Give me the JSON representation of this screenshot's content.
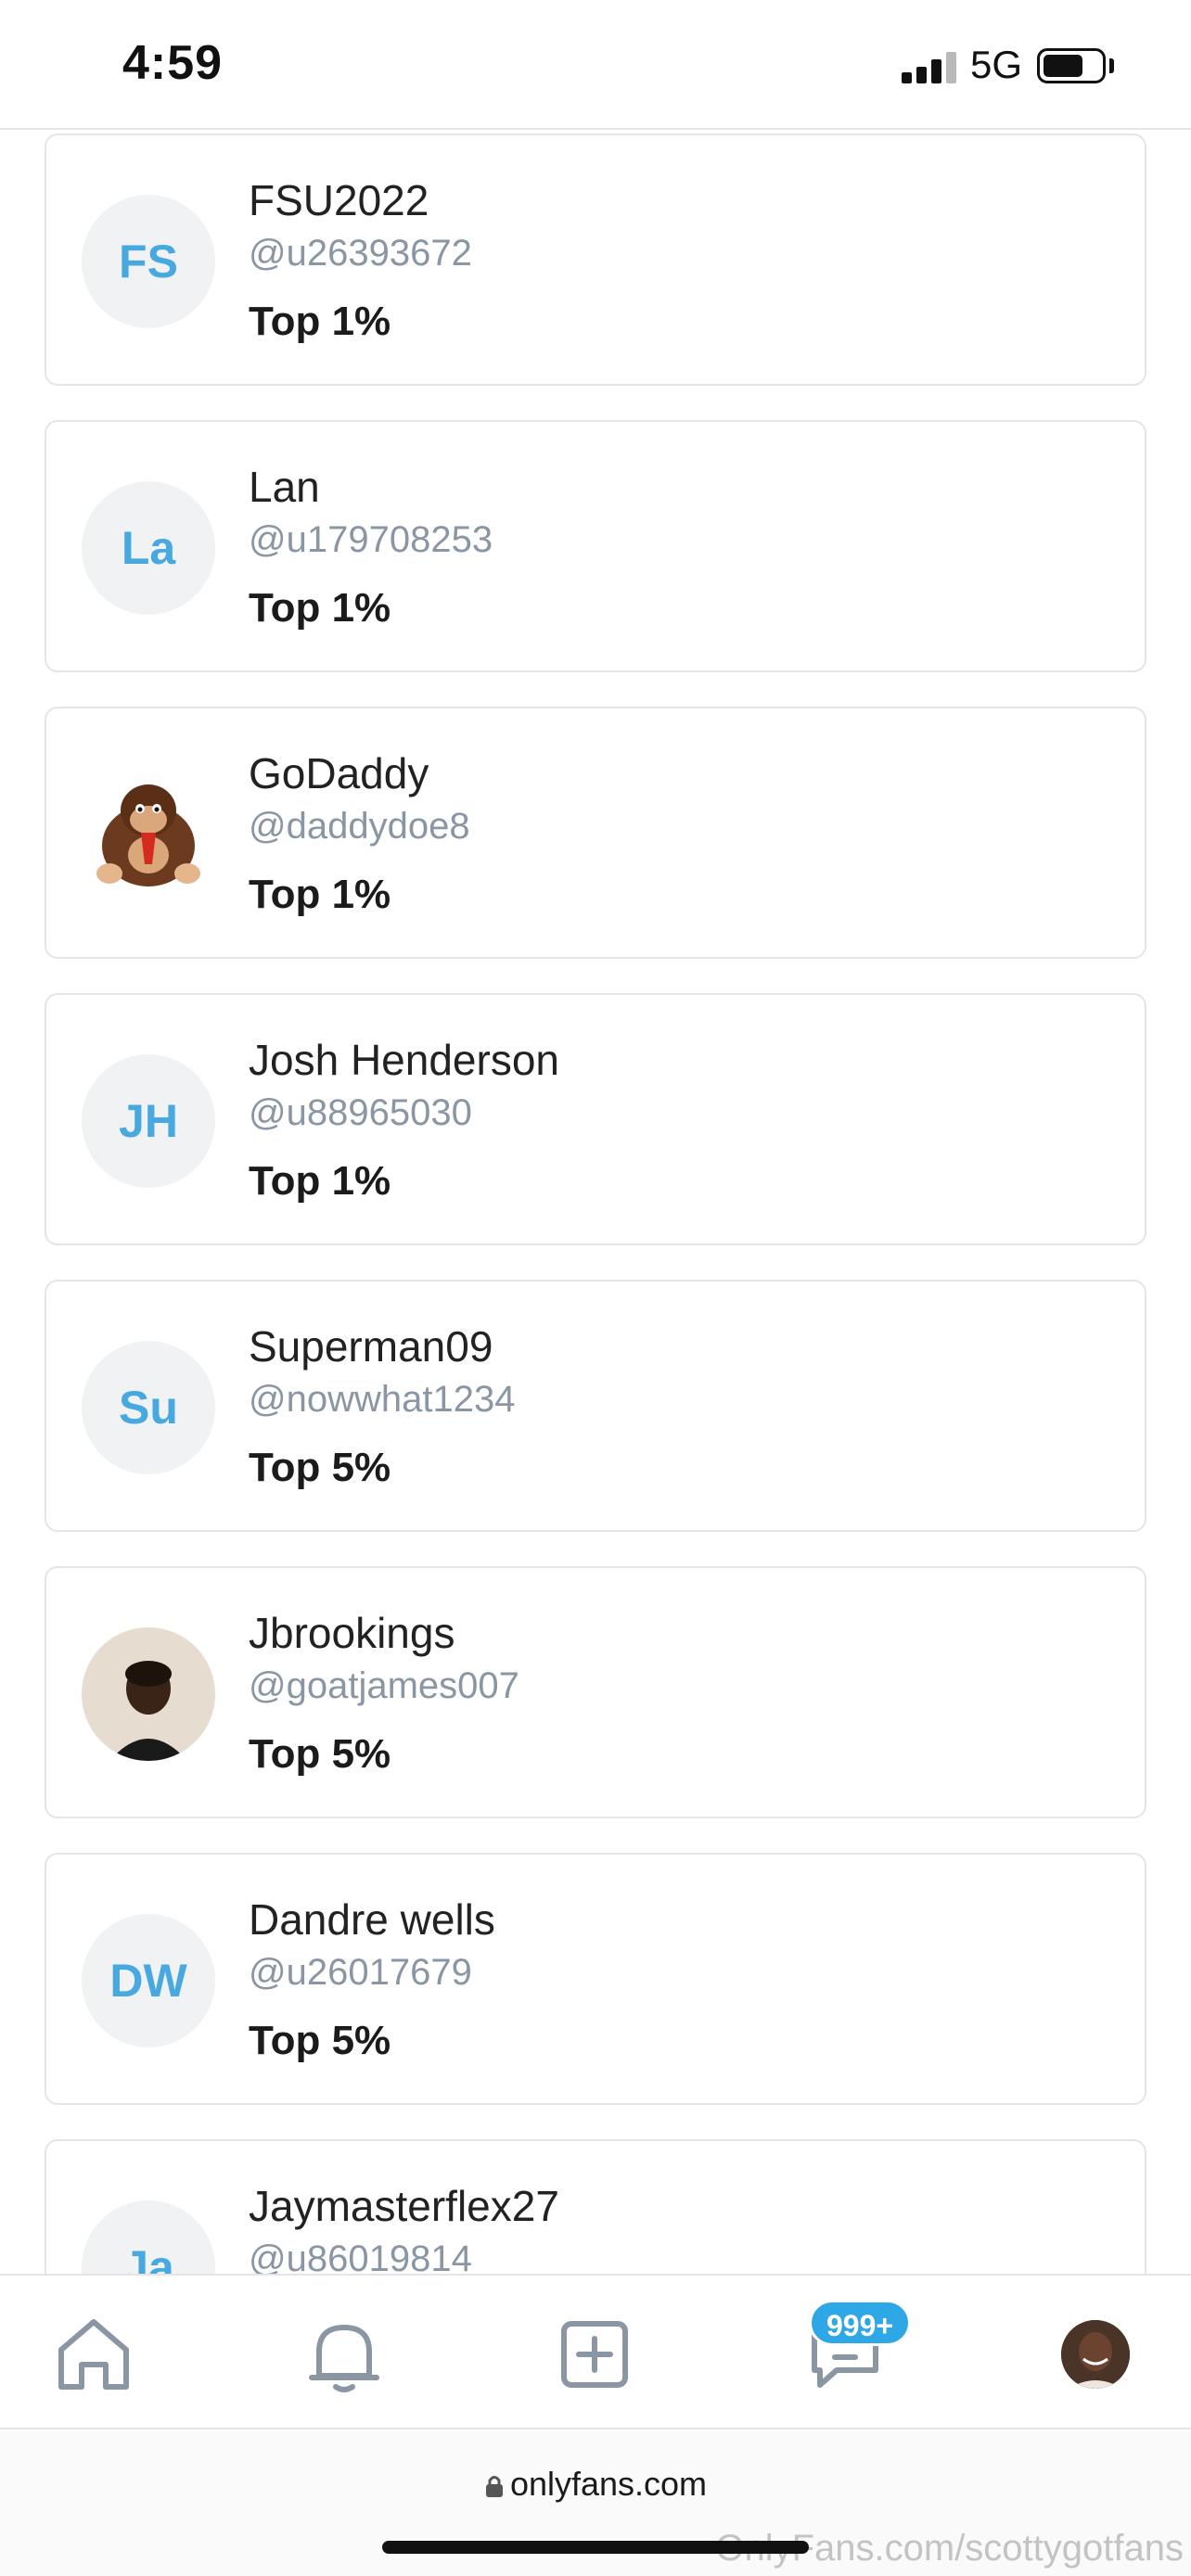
{
  "status_bar": {
    "time": "4:59",
    "network": "5G",
    "battery_level": 0.7
  },
  "fans": [
    {
      "name": "FSU2022",
      "handle": "@u26393672",
      "rank": "Top 1%",
      "initials": "FS",
      "avatar": "initials"
    },
    {
      "name": "Lan",
      "handle": "@u179708253",
      "rank": "Top 1%",
      "initials": "La",
      "avatar": "initials"
    },
    {
      "name": "GoDaddy",
      "handle": "@daddydoe8",
      "rank": "Top 1%",
      "initials": "",
      "avatar": "gorilla-character"
    },
    {
      "name": "Josh Henderson",
      "handle": "@u88965030",
      "rank": "Top 1%",
      "initials": "JH",
      "avatar": "initials"
    },
    {
      "name": "Superman09",
      "handle": "@nowwhat1234",
      "rank": "Top 5%",
      "initials": "Su",
      "avatar": "initials"
    },
    {
      "name": "Jbrookings",
      "handle": "@goatjames007",
      "rank": "Top 5%",
      "initials": "",
      "avatar": "photo"
    },
    {
      "name": "Dandre wells",
      "handle": "@u26017679",
      "rank": "Top 5%",
      "initials": "DW",
      "avatar": "initials"
    },
    {
      "name": "Jaymasterflex27",
      "handle": "@u86019814",
      "rank": "",
      "initials": "Ja",
      "avatar": "initials"
    }
  ],
  "bottom_nav": {
    "items": [
      "home-icon",
      "bell-icon",
      "add-post-icon",
      "messages-icon",
      "profile-avatar"
    ],
    "messages_badge": "999+"
  },
  "browser": {
    "url": "onlyfans.com"
  },
  "watermark": "OnlyFans.com/scottygotfans",
  "colors": {
    "accent": "#47a9e0",
    "badge": "#2ea7e6",
    "muted": "#8a96a3",
    "border": "#e3e5e8",
    "icon": "#8a96a3"
  }
}
